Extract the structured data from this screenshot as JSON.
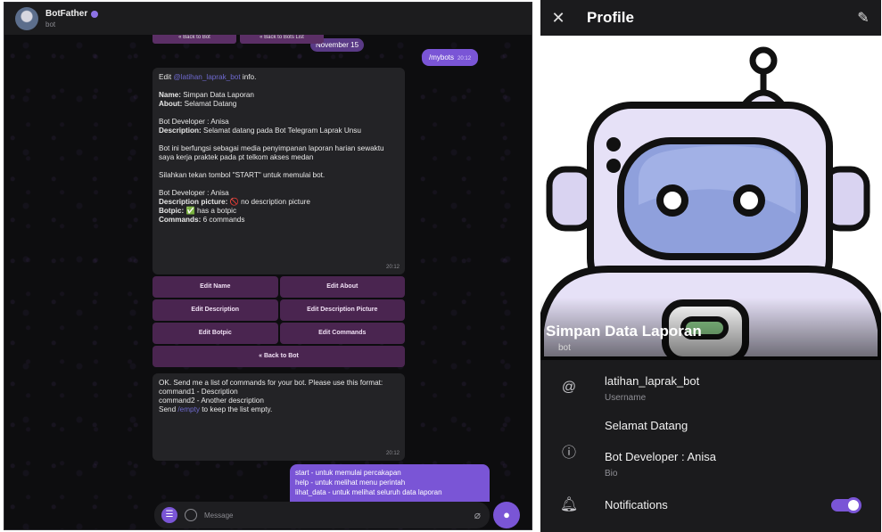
{
  "chat": {
    "header": {
      "name": "BotFather",
      "subtitle": "bot"
    },
    "top_buttons": [
      "« Back to Bot",
      "« Back to Bots List"
    ],
    "date": "November 15",
    "outgoing_command": {
      "text": "/mybots",
      "time": "20:12"
    },
    "bot_info_message": {
      "line1_prefix": "Edit ",
      "line1_link": "@latihan_laprak_bot",
      "line1_suffix": " info.",
      "name_label": "Name:",
      "name_value": " Simpan Data Laporan",
      "about_label": "About:",
      "about_value": " Selamat Datang",
      "dev1": "Bot Developer : Anisa",
      "desc_label": "Description:",
      "desc_value": " Selamat datang pada Bot Telegram Laprak Unsu",
      "para1": "Bot ini berfungsi sebagai media penyimpanan laporan harian sewaktu saya kerja praktek pada pt telkom akses medan",
      "para2": "Silahkan tekan tombol \"START\" untuk memulai bot.",
      "dev2": "Bot Developer : Anisa",
      "pic_label": "Description picture:",
      "pic_value": " 🚫 no description picture",
      "botpic_label": "Botpic:",
      "botpic_value": " ✅ has a botpic",
      "commands_label": "Commands:",
      "commands_value": " 6 commands",
      "time": "20:12"
    },
    "keyboard": [
      "Edit Name",
      "Edit About",
      "Edit Description",
      "Edit Description Picture",
      "Edit Botpic",
      "Edit Commands",
      "« Back to Bot"
    ],
    "commands_prompt": {
      "line1": "OK. Send me a list of commands for your bot. Please use this format:",
      "line2": "command1 - Description",
      "line3": "command2 - Another description",
      "line4_prefix": "Send ",
      "line4_link": "/empty",
      "line4_suffix": " to keep the list empty.",
      "time": "20:12"
    },
    "outgoing_list": [
      "start - untuk memulai percakapan",
      "help - untuk melihat menu perintah",
      "lihat_data - untuk melihat seluruh data laporan"
    ],
    "input_placeholder": "Message",
    "icons": {
      "menu": "menu-icon",
      "emoji": "emoji-icon",
      "attach": "paperclip-icon",
      "mic": "microphone-icon"
    }
  },
  "profile": {
    "title": "Profile",
    "bot_name": "Simpan Data Laporan",
    "bot_type": "bot",
    "username": "latihan_laprak_bot",
    "username_label": "Username",
    "bio_line1": "Selamat Datang",
    "bio_line2": "Bot Developer : Anisa",
    "bio_label": "Bio",
    "notifications_label": "Notifications",
    "notifications_on": true,
    "accent": "#7a55d6"
  }
}
